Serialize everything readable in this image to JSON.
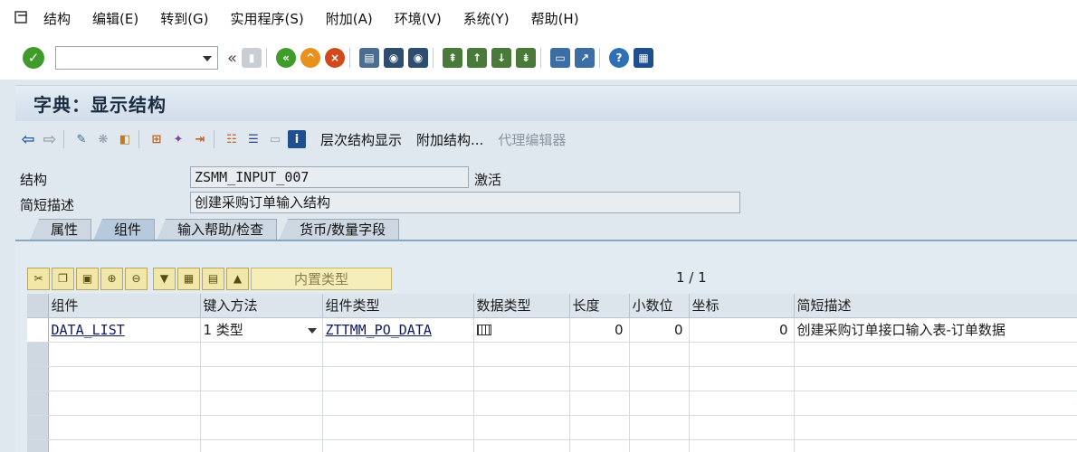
{
  "menubar": {
    "items": [
      "结构",
      "编辑(E)",
      "转到(G)",
      "实用程序(S)",
      "附加(A)",
      "环境(V)",
      "系统(Y)",
      "帮助(H)"
    ]
  },
  "toolbar": {
    "command_value": "",
    "double_arrow": "«"
  },
  "title": "字典：显示结构",
  "app_toolbar": {
    "hierarchy_label": "层次结构显示",
    "append_label": "附加结构...",
    "proxy_label": "代理编辑器"
  },
  "header": {
    "structure_label": "结构",
    "structure_value": "ZSMM_INPUT_007",
    "status": "激活",
    "desc_label": "简短描述",
    "desc_value": "创建采购订单输入结构"
  },
  "tabs": [
    "属性",
    "组件",
    "输入帮助/检查",
    "货币/数量字段"
  ],
  "active_tab": "组件",
  "table_toolbar": {
    "builtin_type_label": "内置类型",
    "pager": "1 / 1"
  },
  "table": {
    "columns": [
      "组件",
      "键入方法",
      "组件类型",
      "数据类型",
      "长度",
      "小数位",
      "坐标",
      "简短描述"
    ],
    "rows": [
      {
        "component": "DATA_LIST",
        "typing": "1 类型",
        "comp_type": "ZTTMM_PO_DATA",
        "length": "0",
        "decimals": "0",
        "coord": "0",
        "desc": "创建采购订单接口输入表-订单数据"
      }
    ]
  },
  "colors": {
    "accent": "#3f9b2a",
    "title_bar": "#d1dde9",
    "table_toolbar": "#f1e7a8"
  }
}
